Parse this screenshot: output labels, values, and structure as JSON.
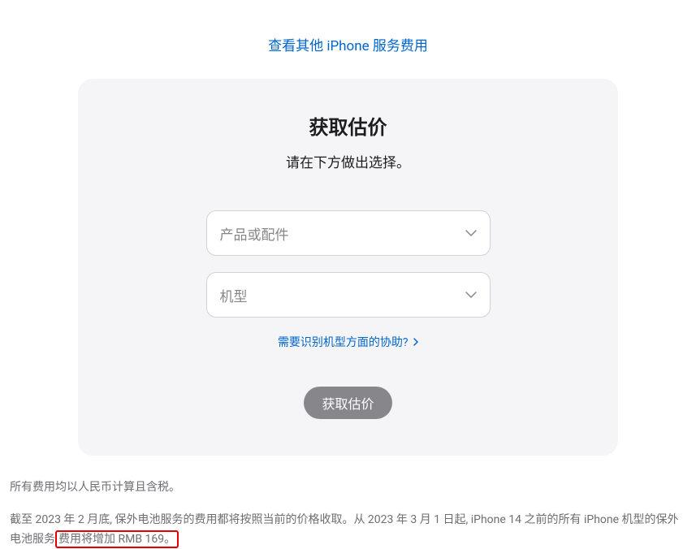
{
  "top_link": "查看其他 iPhone 服务费用",
  "card": {
    "title": "获取估价",
    "subtitle": "请在下方做出选择。",
    "select_product_placeholder": "产品或配件",
    "select_model_placeholder": "机型",
    "help_link": "需要识别机型方面的协助?",
    "submit_label": "获取估价"
  },
  "footer": {
    "line1": "所有费用均以人民币计算且含税。",
    "line2_part1": "截至 2023 年 2 月底, 保外电池服务的费用都将按照当前的价格收取。从 2023 年 3 月 1 日起, iPhone 14 之前的所有 iPhone 机型的保外电池服务",
    "line2_highlight": "费用将增加 RMB 169。"
  }
}
